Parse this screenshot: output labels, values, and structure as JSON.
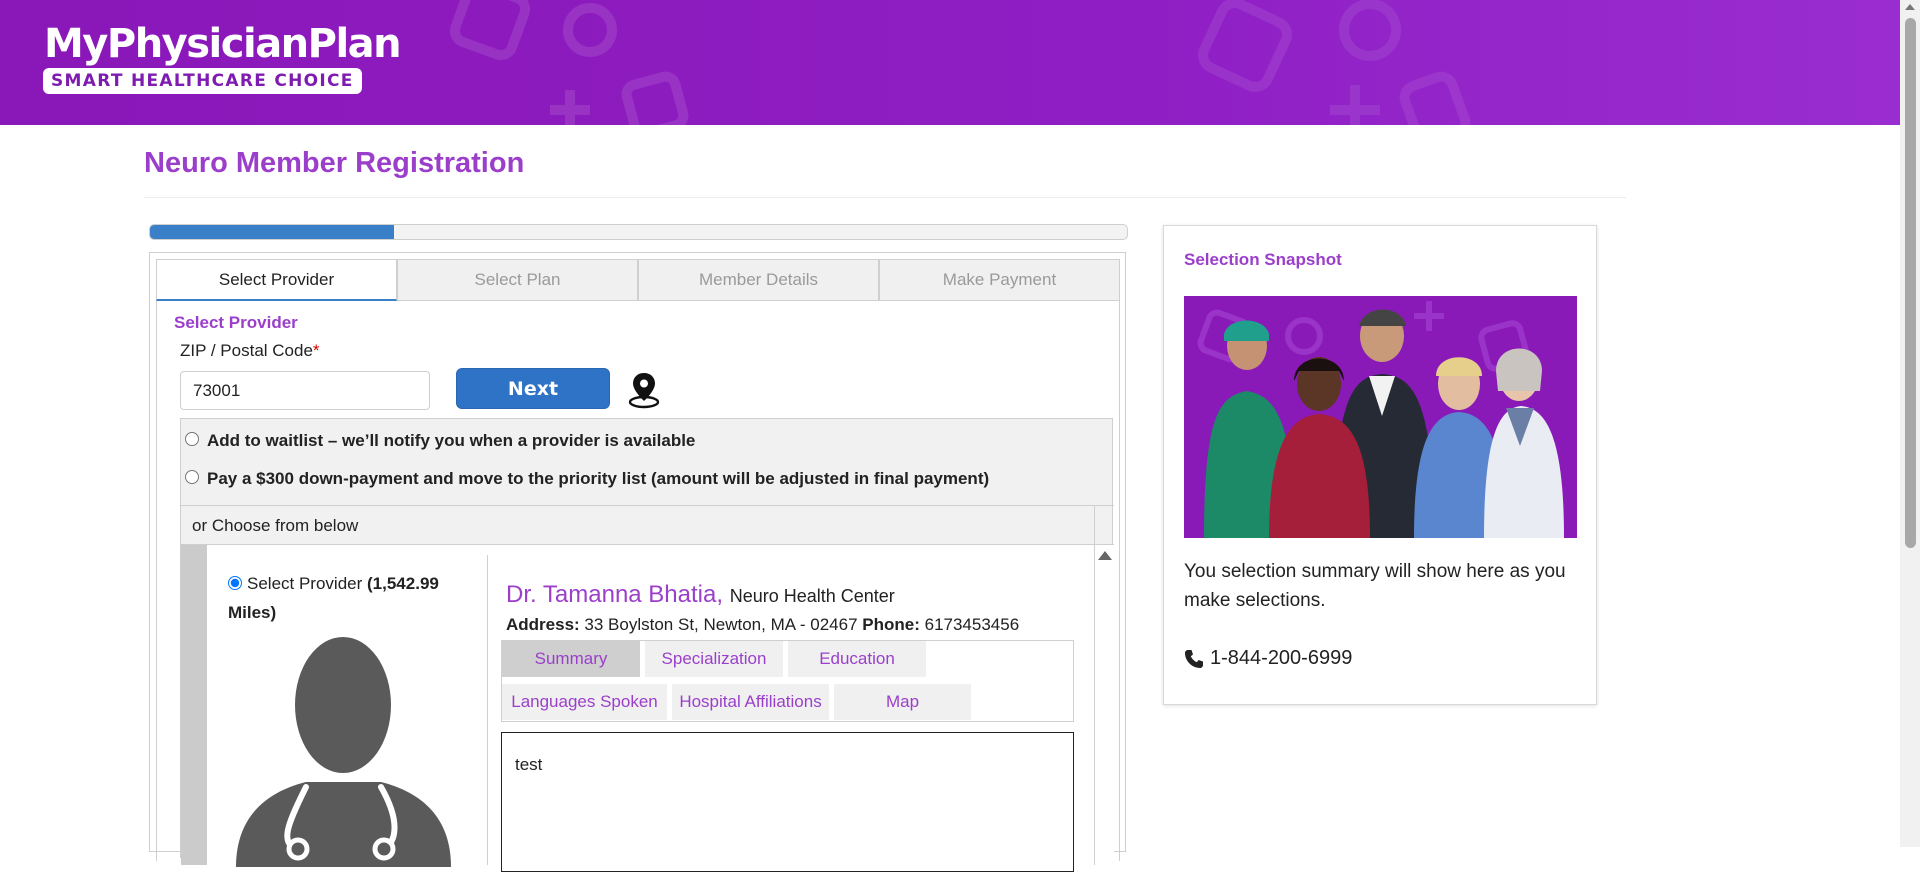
{
  "header": {
    "brand_name": "MyPhysicianPlan",
    "brand_tagline": "SMART HEALTHCARE CHOICE"
  },
  "page": {
    "title": "Neuro Member Registration",
    "progress_percent": 25
  },
  "wizard": {
    "tabs": [
      {
        "label": "Select Provider",
        "active": true
      },
      {
        "label": "Select Plan",
        "active": false
      },
      {
        "label": "Member Details",
        "active": false
      },
      {
        "label": "Make Payment",
        "active": false
      }
    ],
    "section_label": "Select Provider",
    "zip_label": "ZIP / Postal Code",
    "zip_required_mark": "*",
    "zip_value": "73001",
    "next_label": "Next",
    "location_icon": "map-pin-icon"
  },
  "options": {
    "waitlist_label": "Add to waitlist – we’ll notify you when a provider is available",
    "priority_label": "Pay a $300 down-payment and move to the priority list (amount will be adjusted in final payment)",
    "choose_label": "or Choose from below"
  },
  "provider": {
    "select_label": "Select Provider",
    "distance": "(1,542.99 Miles)",
    "name": "Dr. Tamanna Bhatia,",
    "center": "Neuro Health Center",
    "address_label": "Address:",
    "address": "33 Boylston St, Newton, MA - 02467",
    "phone_label": "Phone:",
    "phone": "6173453456",
    "tabs": [
      {
        "label": "Summary",
        "active": true
      },
      {
        "label": "Specialization",
        "active": false
      },
      {
        "label": "Education",
        "active": false
      },
      {
        "label": "Languages Spoken",
        "active": false
      },
      {
        "label": "Hospital Affiliations",
        "active": false
      },
      {
        "label": "Map",
        "active": false
      }
    ],
    "summary_text": "test"
  },
  "snapshot": {
    "title": "Selection Snapshot",
    "text": "You selection summary will show here as you make selections.",
    "phone": "1-844-200-6999",
    "phone_icon": "phone-icon"
  },
  "colors": {
    "brand_purple": "#8a17b8",
    "accent_purple": "#9b3fcb",
    "primary_blue": "#2f73c6"
  }
}
